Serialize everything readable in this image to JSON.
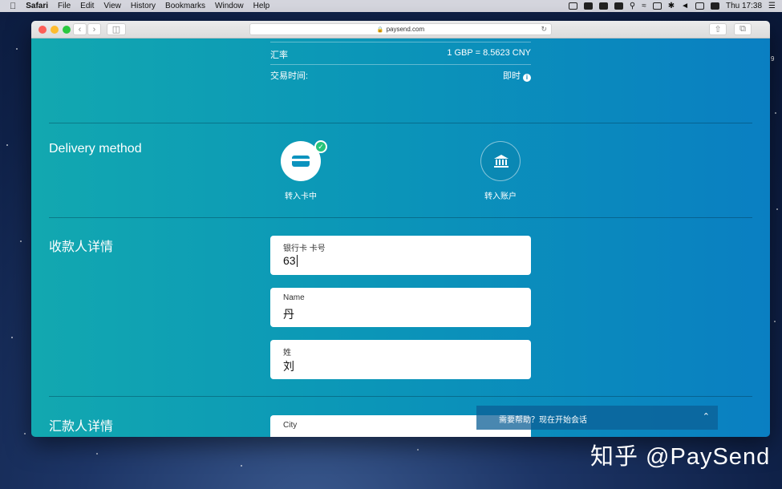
{
  "menubar": {
    "app": "Safari",
    "items": [
      "File",
      "Edit",
      "View",
      "History",
      "Bookmarks",
      "Window",
      "Help"
    ],
    "clock": "Thu 17:38"
  },
  "browser": {
    "url": "paysend.com"
  },
  "page": {
    "exchange_rate_label": "汇率",
    "exchange_rate_value": "1 GBP = 8.5623 CNY",
    "transfer_time_label": "交易时间:",
    "transfer_time_value": "即时",
    "delivery_section_title": "Delivery method",
    "delivery_options": [
      {
        "label": "转入卡中",
        "icon": "card-icon",
        "selected": true
      },
      {
        "label": "转入账户",
        "icon": "bank-icon",
        "selected": false
      }
    ],
    "recipient_section_title": "收款人详情",
    "recipient_fields": [
      {
        "label": "银行卡 卡号",
        "value": "63"
      },
      {
        "label": "Name",
        "value": "丹"
      },
      {
        "label": "姓",
        "value": "刘"
      }
    ],
    "sender_section_title": "汇款人详情",
    "sender_fields": [
      {
        "label": "City",
        "value": ""
      }
    ],
    "chat_text": "需要帮助？现在开始会话"
  },
  "side_digit": "9",
  "watermark": "知乎 @PaySend"
}
